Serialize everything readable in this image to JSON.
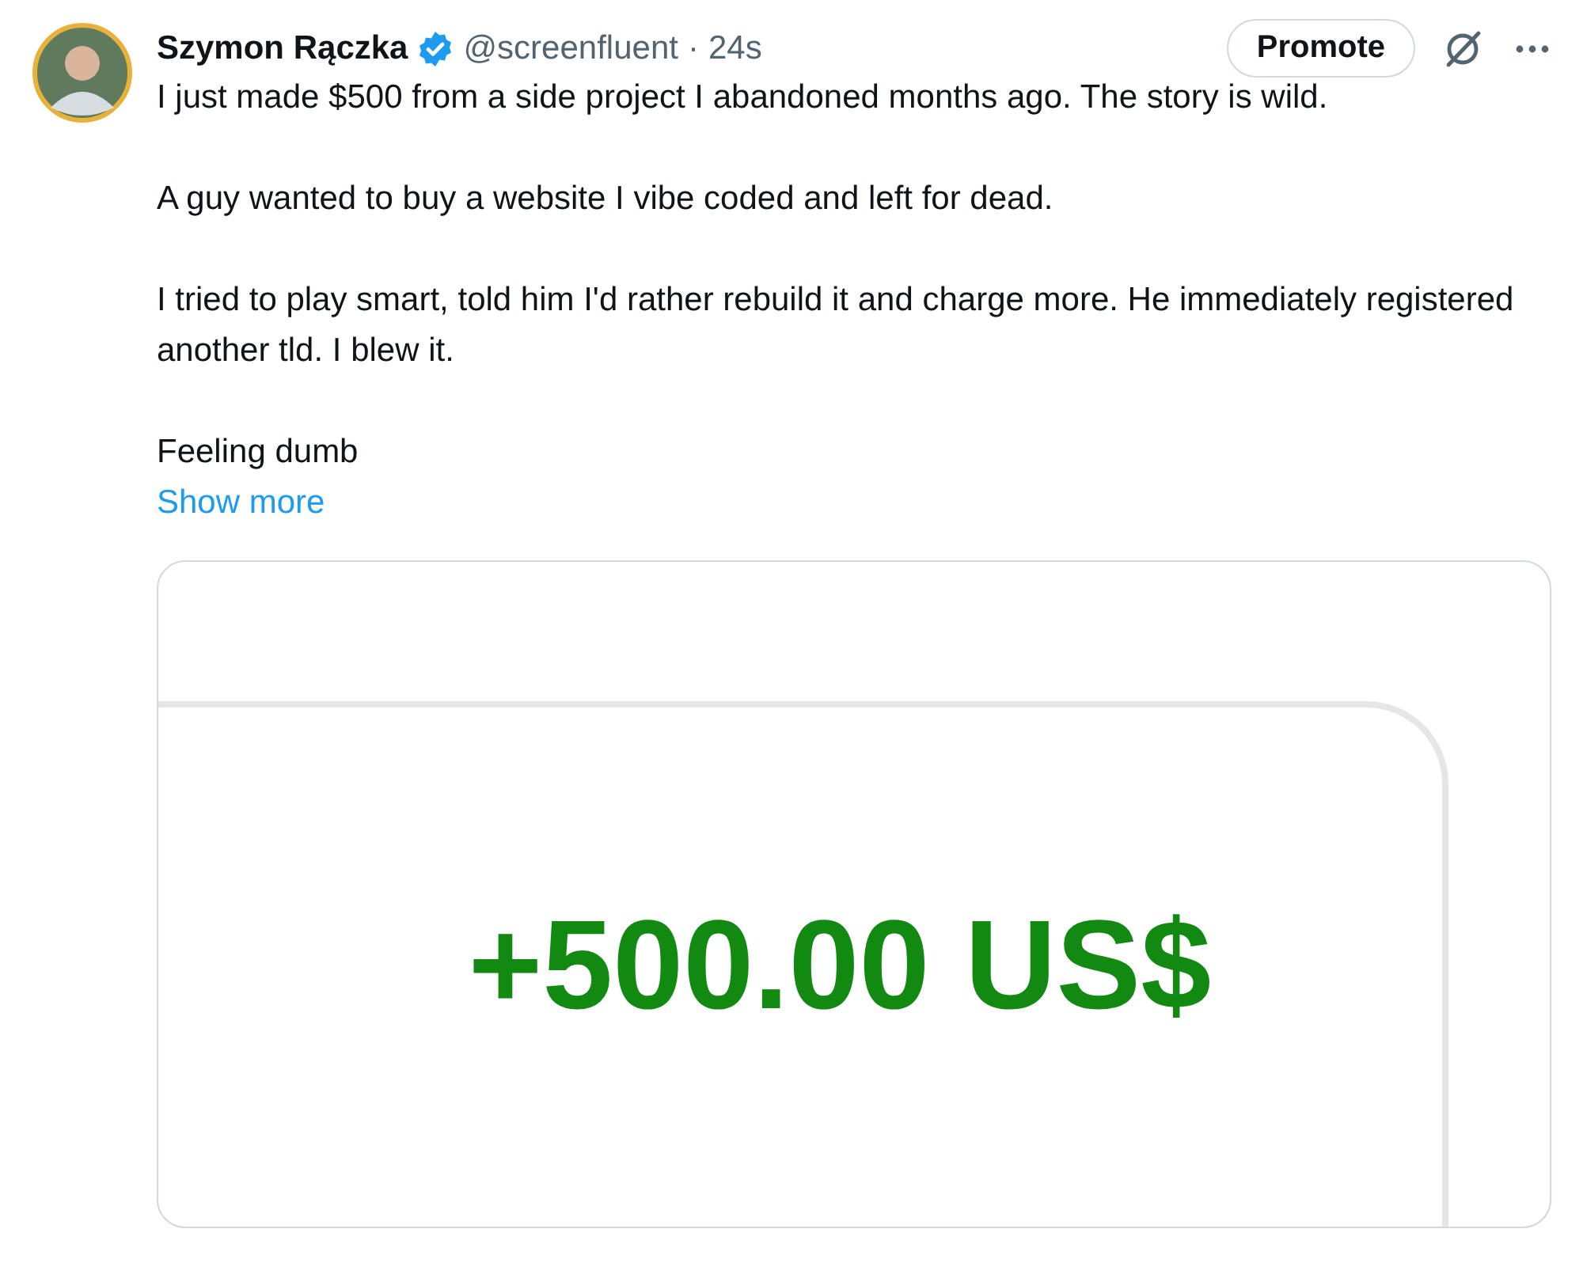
{
  "author": {
    "name": "Szymon Rączka",
    "verified": true,
    "handle": "@screenfluent",
    "separator": "·",
    "time": "24s"
  },
  "promote_button": "Promote",
  "paragraphs": [
    "I just made $500 from a side project I abandoned months ago. The story is wild.",
    "A guy wanted to buy a website I vibe coded and left for dead.",
    "I tried to play smart, told him I'd rather rebuild it and charge more. He immediately registered another tld. I blew it.",
    "Feeling dumb"
  ],
  "show_more": "Show more",
  "media": {
    "amount": "+500.00 US$"
  }
}
